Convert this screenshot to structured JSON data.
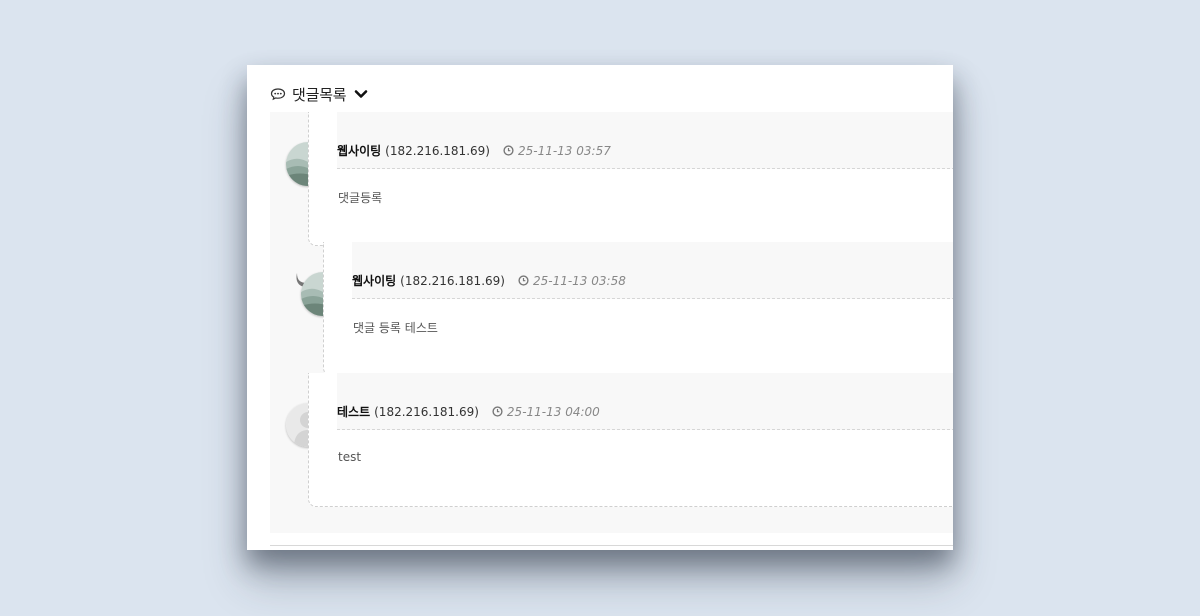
{
  "section": {
    "title": "댓글목록",
    "icon": "speech-bubble-icon",
    "toggle_icon": "chevron-down-icon"
  },
  "comments": [
    {
      "author": "웹사이팅",
      "ip": "(182.216.181.69)",
      "date": "25-11-13 03:57",
      "content": "댓글등록",
      "avatar": "landscape-avatar",
      "is_reply": false
    },
    {
      "author": "웹사이팅",
      "ip": "(182.216.181.69)",
      "date": "25-11-13 03:58",
      "content": "댓글 등록 테스트",
      "avatar": "landscape-avatar",
      "is_reply": true
    },
    {
      "author": "테스트",
      "ip": "(182.216.181.69)",
      "date": "25-11-13 04:00",
      "content": "test",
      "avatar": "default-user-avatar",
      "is_reply": false
    }
  ],
  "colors": {
    "page_bg": "#dbe4ef",
    "list_bg": "#f8f8f8",
    "date_text": "#888888"
  }
}
